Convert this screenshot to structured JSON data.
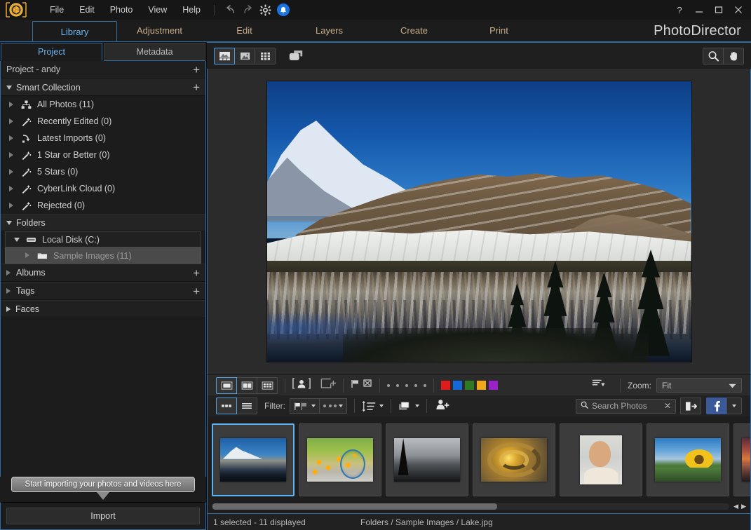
{
  "window": {
    "app_title": "PhotoDirector",
    "help_label": "?",
    "minimize_label": "—",
    "maximize_label": "❐",
    "close_label": "✕"
  },
  "menu": {
    "items": [
      {
        "label": "File"
      },
      {
        "label": "Edit"
      },
      {
        "label": "Photo"
      },
      {
        "label": "View"
      },
      {
        "label": "Help"
      }
    ],
    "icons": [
      "undo-icon",
      "redo-icon",
      "settings-gear-icon",
      "notification-bell-icon"
    ]
  },
  "modules": {
    "tabs": [
      {
        "label": "Library",
        "active": true
      },
      {
        "label": "Adjustment",
        "active": false
      },
      {
        "label": "Edit",
        "active": false
      },
      {
        "label": "Layers",
        "active": false
      },
      {
        "label": "Create",
        "active": false
      },
      {
        "label": "Print",
        "active": false
      }
    ]
  },
  "left_panel": {
    "tabs": [
      {
        "label": "Project",
        "active": true
      },
      {
        "label": "Metadata",
        "active": false
      }
    ],
    "project_header": {
      "label": "Project - andy",
      "add_label": "+"
    },
    "smart_collection": {
      "label": "Smart Collection",
      "add_label": "+",
      "items": [
        {
          "label": "All Photos (11)",
          "icon": "collection-icon"
        },
        {
          "label": "Recently Edited (0)",
          "icon": "magic-wand-icon"
        },
        {
          "label": "Latest Imports (0)",
          "icon": "import-arrow-icon"
        },
        {
          "label": "1 Star or Better (0)",
          "icon": "magic-wand-icon"
        },
        {
          "label": "5 Stars (0)",
          "icon": "magic-wand-icon"
        },
        {
          "label": "CyberLink Cloud (0)",
          "icon": "magic-wand-icon"
        },
        {
          "label": "Rejected (0)",
          "icon": "magic-wand-icon"
        }
      ]
    },
    "folders": {
      "label": "Folders",
      "items": [
        {
          "label": "Local Disk (C:)",
          "icon": "drive-icon",
          "expanded": true,
          "selected": false
        },
        {
          "label": "Sample Images (11)",
          "icon": "folder-icon",
          "expanded": false,
          "selected": true
        }
      ]
    },
    "albums": {
      "label": "Albums",
      "add_label": "+"
    },
    "tags": {
      "label": "Tags",
      "add_label": "+"
    },
    "faces": {
      "label": "Faces"
    },
    "tooltip": {
      "text": "Start importing your photos and videos here"
    },
    "import_button": {
      "label": "Import"
    }
  },
  "view_toolbar": {
    "buttons": [
      {
        "name": "viewer-filmstrip-mode",
        "icon": "viewer-with-strip-icon",
        "active": true
      },
      {
        "name": "viewer-single-mode",
        "icon": "single-photo-icon",
        "active": false
      },
      {
        "name": "viewer-grid-mode",
        "icon": "grid-icon",
        "active": false
      },
      {
        "name": "viewer-compare-mode",
        "icon": "dual-window-icon",
        "active": false
      }
    ],
    "right_buttons": [
      {
        "name": "zoom-tool",
        "icon": "magnifier-icon"
      },
      {
        "name": "pan-tool",
        "icon": "hand-icon"
      }
    ]
  },
  "bottom_toolbar": {
    "view_modes": [
      {
        "name": "single-view",
        "icon": "single-pane-icon",
        "active": true
      },
      {
        "name": "compare-view",
        "icon": "two-pane-icon",
        "active": false
      },
      {
        "name": "multi-view",
        "icon": "multi-pane-icon",
        "active": false
      }
    ],
    "face_tag_icon": "face-tag-icon",
    "add_region_icon": "add-region-icon",
    "flag_icons": [
      "flag-icon",
      "reject-flag-icon"
    ],
    "rating_dots": 5,
    "color_labels": [
      "#e01b1b",
      "#1569d6",
      "#2d7a22",
      "#f0a81a",
      "#9b21c9"
    ],
    "sort_icon": "sort-list-icon",
    "zoom": {
      "label": "Zoom:",
      "value": "Fit"
    }
  },
  "filter_toolbar": {
    "view_toggle": [
      {
        "name": "thumbnail-view",
        "icon": "thumb-view-icon",
        "active": true
      },
      {
        "name": "list-view",
        "icon": "list-view-icon",
        "active": false
      }
    ],
    "filter_label": "Filter:",
    "filter_buttons": [
      {
        "name": "filter-flag",
        "icon": "flag-filter-icon"
      },
      {
        "name": "filter-more",
        "icon": "more-dots-icon"
      }
    ],
    "sort_order_icon": "sort-order-icon",
    "stack_icon": "stack-icon",
    "face_add_icon": "face-add-icon",
    "search": {
      "placeholder": "Search Photos",
      "value": "",
      "clear_label": "✕"
    },
    "export_icon": "export-icon",
    "facebook_icon": "facebook-icon",
    "share_caret": "chevron-down-icon"
  },
  "preview": {
    "photo_name": "Lake.jpg",
    "photo_alt": "Mountain lake with snowy peaks and reflection"
  },
  "filmstrip": {
    "thumbnails": [
      {
        "name": "thumb-lake",
        "art": "tn-lake",
        "selected": true,
        "orientation": "landscape"
      },
      {
        "name": "thumb-bike",
        "art": "tn-bike",
        "selected": false,
        "orientation": "landscape"
      },
      {
        "name": "thumb-bw-beach",
        "art": "tn-bw",
        "selected": false,
        "orientation": "landscape"
      },
      {
        "name": "thumb-spiral-stairs",
        "art": "tn-spiral",
        "selected": false,
        "orientation": "landscape"
      },
      {
        "name": "thumb-portrait-woman",
        "art": "tn-face",
        "selected": false,
        "orientation": "portrait"
      },
      {
        "name": "thumb-sunflower",
        "art": "tn-sun",
        "selected": false,
        "orientation": "landscape"
      },
      {
        "name": "thumb-sunset",
        "art": "tn-sunset",
        "selected": false,
        "orientation": "landscape"
      }
    ],
    "scroll_left_label": "◀",
    "scroll_right_label": "▶"
  },
  "status_bar": {
    "selection": "1 selected - 11 displayed",
    "path": "Folders / Sample Images / Lake.jpg"
  },
  "colors": {
    "accent_blue": "#2e6da4",
    "active_tab_blue": "#6ab4f0",
    "module_text": "#c8ad8a",
    "selection_blue": "#5bb3f5"
  }
}
